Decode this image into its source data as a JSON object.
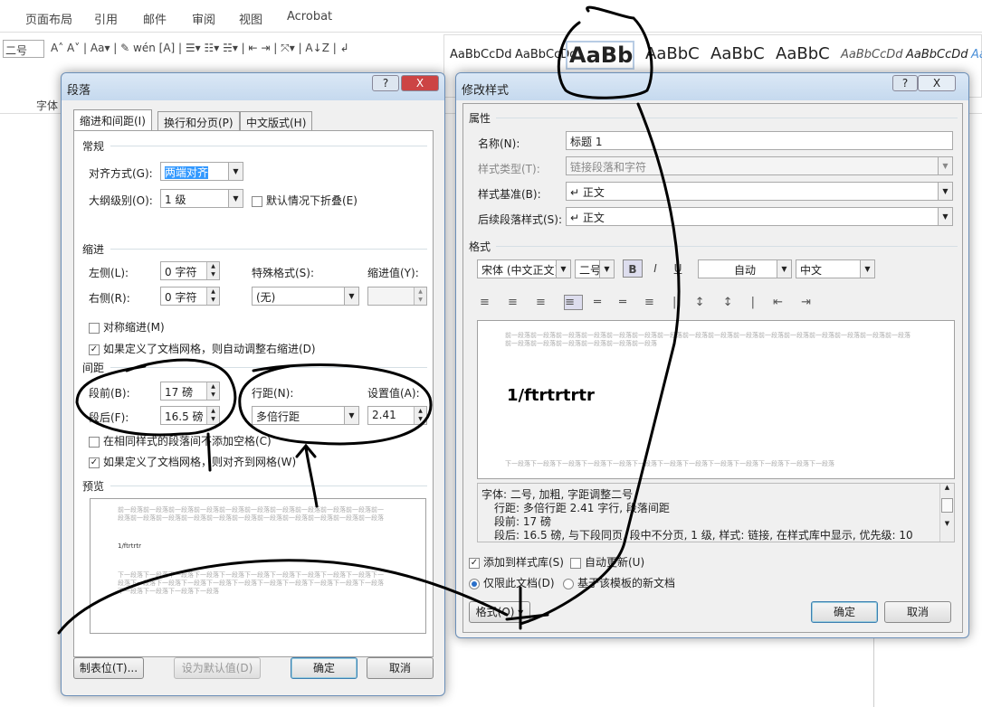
{
  "menu": [
    "页面布局",
    "引用",
    "邮件",
    "审阅",
    "视图",
    "Acrobat"
  ],
  "ribbon": {
    "font_size": "二号",
    "font_group_label": "字体",
    "styles_gallery": [
      "AaBbCcDd",
      "AaBbCcDd",
      "AaBb",
      "AaBbC",
      "AaBbC",
      "AaBbC",
      "AaBbCcDd",
      "AaBbCcDd",
      "Aa"
    ]
  },
  "para_dialog": {
    "title": "段落",
    "help": "?",
    "close": "X",
    "tabs": [
      "缩进和间距(I)",
      "换行和分页(P)",
      "中文版式(H)"
    ],
    "general": {
      "heading": "常规",
      "align_label": "对齐方式(G):",
      "align_value": "两端对齐",
      "outline_label": "大纲级别(O):",
      "outline_value": "1 级",
      "collapse_label": "默认情况下折叠(E)"
    },
    "indent": {
      "heading": "缩进",
      "left_label": "左侧(L):",
      "left_value": "0 字符",
      "right_label": "右侧(R):",
      "right_value": "0 字符",
      "special_label": "特殊格式(S):",
      "special_value": "(无)",
      "by_label": "缩进值(Y):",
      "by_value": "",
      "mirror_label": "对称缩进(M)",
      "auto_label": "如果定义了文档网格，则自动调整右缩进(D)"
    },
    "spacing": {
      "heading": "间距",
      "before_label": "段前(B):",
      "before_value": "17 磅",
      "after_label": "段后(F):",
      "after_value": "16.5 磅",
      "line_label": "行距(N):",
      "line_value": "多倍行距",
      "at_label": "设置值(A):",
      "at_value": "2.41",
      "nospace_label": "在相同样式的段落间不添加空格(C)",
      "grid_label": "如果定义了文档网格，则对齐到网格(W)"
    },
    "preview": {
      "heading": "预览",
      "before_text": "前一段落前一段落前一段落前一段落前一段落前一段落前一段落前一段落前一段落前一段落前一段落前一段落前一段落前一段落前一段落前一段落前一段落前一段落前一段落前一段落前一段落",
      "sample": "1/ftrtrtr",
      "after_text": "下一段落下一段落下一段落下一段落下一段落下一段落下一段落下一段落下一段落下一段落下一段落下一段落下一段落下一段落下一段落下一段落下一段落下一段落下一段落下一段落下一段落下一段落下一段落下一段落下一段落"
    },
    "buttons": {
      "tabs": "制表位(T)...",
      "default": "设为默认值(D)",
      "ok": "确定",
      "cancel": "取消"
    }
  },
  "style_dialog": {
    "title": "修改样式",
    "help": "?",
    "close": "X",
    "props": {
      "heading": "属性",
      "name_label": "名称(N):",
      "name_value": "标题 1",
      "type_label": "样式类型(T):",
      "type_value": "链接段落和字符",
      "based_label": "样式基准(B):",
      "based_value": "↵ 正文",
      "next_label": "后续段落样式(S):",
      "next_value": "↵ 正文"
    },
    "format": {
      "heading": "格式",
      "font": "宋体 (中文正文)",
      "size": "二号",
      "bold": "B",
      "italic": "I",
      "underline": "U",
      "color": "自动",
      "lang": "中文"
    },
    "preview": {
      "before_text": "前一段落前一段落前一段落前一段落前一段落前一段落前一段落前一段落前一段落前一段落前一段落前一段落前一段落前一段落前一段落前一段落前一段落前一段落前一段落前一段落前一段落前一段落",
      "sample": "1/ftrtrtrtr",
      "after_text": "下一段落下一段落下一段落下一段落下一段落下一段落下一段落下一段落下一段落下一段落下一段落下一段落下一段落"
    },
    "description": [
      "字体: 二号, 加粗, 字距调整二号",
      "行距: 多倍行距 2.41 字行, 段落间距",
      "段前: 17 磅",
      "段后: 16.5 磅, 与下段同页, 段中不分页, 1 级, 样式: 链接, 在样式库中显示, 优先级: 10"
    ],
    "add_gallery": "添加到样式库(S)",
    "auto_update": "自动更新(U)",
    "only_doc": "仅限此文档(D)",
    "new_docs": "基于该模板的新文档",
    "buttons": {
      "format": "格式(O) ▾",
      "ok": "确定",
      "cancel": "取消"
    }
  }
}
